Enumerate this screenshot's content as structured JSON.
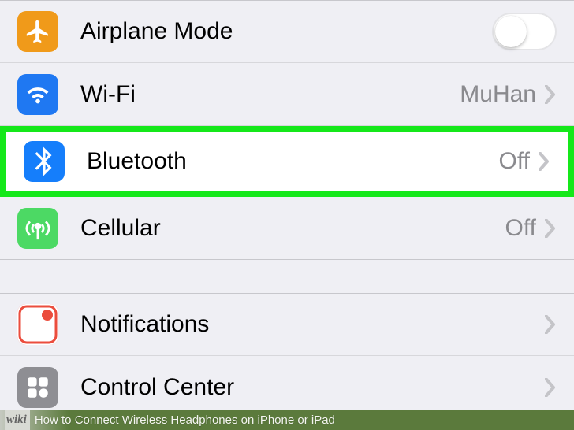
{
  "settings": {
    "group1": [
      {
        "key": "airplane",
        "label": "Airplane Mode",
        "control": "toggle",
        "on": false,
        "icon": "airplane"
      },
      {
        "key": "wifi",
        "label": "Wi-Fi",
        "value": "MuHan",
        "icon": "wifi"
      },
      {
        "key": "bluetooth",
        "label": "Bluetooth",
        "value": "Off",
        "icon": "bluetooth",
        "highlighted": true
      },
      {
        "key": "cellular",
        "label": "Cellular",
        "value": "Off",
        "icon": "cellular"
      }
    ],
    "group2": [
      {
        "key": "notifications",
        "label": "Notifications",
        "icon": "notifications"
      },
      {
        "key": "controlcenter",
        "label": "Control Center",
        "icon": "controlcenter"
      }
    ]
  },
  "footer": {
    "brand": "wiki",
    "title": "How to Connect Wireless Headphones on iPhone or iPad"
  }
}
